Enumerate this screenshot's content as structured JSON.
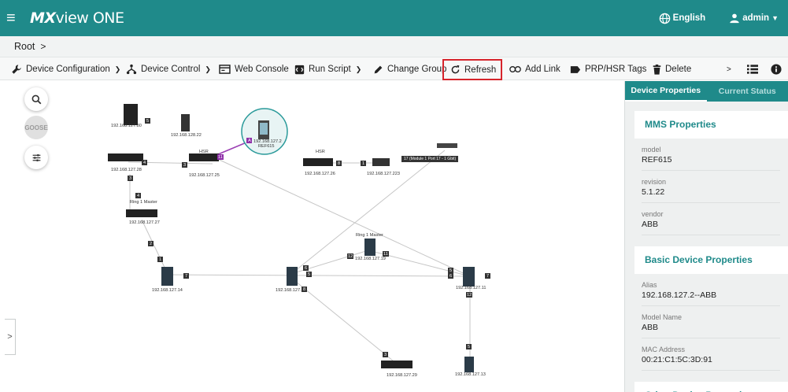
{
  "header": {
    "menu_icon": "hamburger-icon",
    "logo_prefix": "MX",
    "logo_suffix": "view ONE",
    "language": "English",
    "user": "admin",
    "bg_color": "#1f8a8a"
  },
  "breadcrumb": {
    "root": "Root",
    "separator": ">"
  },
  "toolbar": {
    "device_configuration": "Device Configuration",
    "device_control": "Device Control",
    "web_console": "Web Console",
    "run_script": "Run Script",
    "change_group": "Change Group",
    "refresh": "Refresh",
    "add_link": "Add Link",
    "prp_hsr_tags": "PRP/HSR Tags",
    "delete": "Delete",
    "more": ">",
    "highlight_color": "#d6242b"
  },
  "map": {
    "goose_label": "GOOSE",
    "expander": ">",
    "devices": {
      "d1": "192.168.127.80",
      "d2": "192.168.128.22",
      "d3": "192.168.127.28",
      "d4": "192.168.127.25",
      "d5": "192.168.127.2",
      "d5_sub": "REF615",
      "d6": "192.168.127.26",
      "d7": "192.168.127.223",
      "d8": "192.168.127.27",
      "d9": "192.168.127.14",
      "d10": "192.168.127.1",
      "d11": "192.168.127.19",
      "d12": "192.168.127.11",
      "d13": "192.168.127.29",
      "d14": "192.168.127.13"
    },
    "hsr_1": "HSR",
    "hsr_2": "HSR",
    "ring1_master_1": "Ring 1 Master",
    "ring1_master_2": "Ring 1 Master",
    "module_tag": "17 (Module 1 Port 17 - 1 Gbit)",
    "ports": {
      "p_d1": "5",
      "p_d3": "4",
      "p_d3_dn": "3",
      "p_d4_l": "3",
      "p_d4_r": "11",
      "p_d5": "A",
      "p_d6": "8",
      "p_d7": "1",
      "p_d8_up": "4",
      "p_d8_dn": "2",
      "p_d9_up": "1",
      "p_d9_r": "7",
      "p_d10_a": "6",
      "p_d10_b": "5",
      "p_d10_c": "8",
      "p_d11_l": "12",
      "p_d11_r": "11",
      "p_d12_a": "5",
      "p_d12_b": "6",
      "p_d12_r": "7",
      "p_d12_dn": "12",
      "p_d13": "3",
      "p_d14": "5"
    }
  },
  "panel": {
    "tab_properties": "Device Properties",
    "tab_status": "Current Status",
    "mms_title": "MMS Properties",
    "mms": [
      {
        "key": "model",
        "value": "REF615"
      },
      {
        "key": "revision",
        "value": "5.1.22"
      },
      {
        "key": "vendor",
        "value": "ABB"
      }
    ],
    "basic_title": "Basic Device Properties",
    "basic": [
      {
        "key": "Alias",
        "value": "192.168.127.2--ABB"
      },
      {
        "key": "Model Name",
        "value": "ABB"
      },
      {
        "key": "MAC Address",
        "value": "00:21:C1:5C:3D:91"
      }
    ],
    "other_title": "Other Device Properties"
  }
}
